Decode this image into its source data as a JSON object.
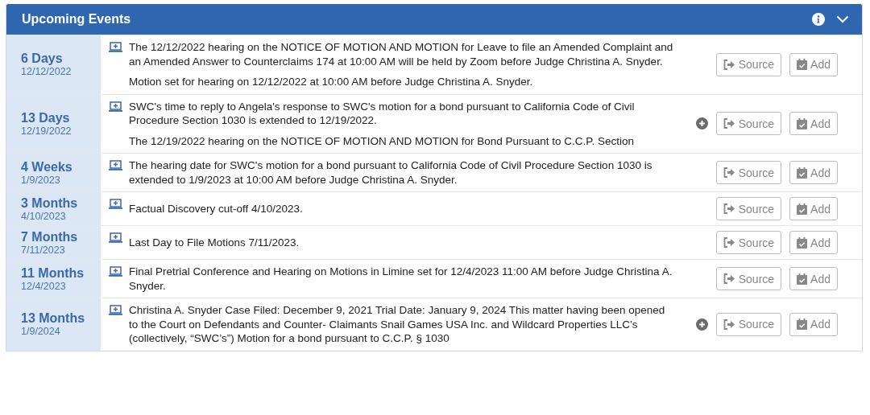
{
  "panel": {
    "title": "Upcoming Events"
  },
  "events": [
    {
      "countdown": "6 Days",
      "date": "12/12/2022",
      "expandable": false,
      "paragraphs": [
        "The 12/12/2022 hearing on the NOTICE OF MOTION AND MOTION for Leave to file an Amended Complaint and an Amended Answer to Counterclaims 174 at 10:00 AM will be held by Zoom before Judge Christina A. Snyder.",
        "Motion set for hearing on 12/12/2022 at 10:00 AM before Judge Christina A. Snyder."
      ],
      "source": "Source",
      "add": "Add"
    },
    {
      "countdown": "13 Days",
      "date": "12/19/2022",
      "expandable": true,
      "paragraphs": [
        "SWC's time to reply to Angela's response to SWC's motion for a bond pursuant to California Code of Civil Procedure Section 1030 is extended to 12/19/2022.",
        "The 12/19/2022 hearing on the NOTICE OF MOTION AND MOTION for Bond Pursuant to C.C.P. Section"
      ],
      "source": "Source",
      "add": "Add"
    },
    {
      "countdown": "4 Weeks",
      "date": "1/9/2023",
      "expandable": false,
      "paragraphs": [
        "The hearing date for SWC's motion for a bond pursuant to California Code of Civil Procedure Section 1030 is extended to 1/9/2023 at 10:00 AM before Judge Christina A. Snyder."
      ],
      "source": "Source",
      "add": "Add"
    },
    {
      "countdown": "3 Months",
      "date": "4/10/2023",
      "expandable": false,
      "paragraphs": [
        "Factual Discovery cut-off 4/10/2023."
      ],
      "source": "Source",
      "add": "Add"
    },
    {
      "countdown": "7 Months",
      "date": "7/11/2023",
      "expandable": false,
      "paragraphs": [
        "Last Day to File Motions 7/11/2023."
      ],
      "source": "Source",
      "add": "Add"
    },
    {
      "countdown": "11 Months",
      "date": "12/4/2023",
      "expandable": false,
      "paragraphs": [
        "Final Pretrial Conference and Hearing on Motions in Limine set for 12/4/2023 11:00 AM before Judge Christina A. Snyder."
      ],
      "source": "Source",
      "add": "Add"
    },
    {
      "countdown": "13 Months",
      "date": "1/9/2024",
      "expandable": true,
      "paragraphs": [
        "Christina A. Snyder Case Filed: December 9, 2021 Trial Date: January 9, 2024 This matter having been opened to the Court on Defendants and Counter- Claimants Snail Games USA Inc. and Wildcard Properties LLC’s (collectively, “SWC’s”) Motion for a bond pursuant to C.C.P. § 1030"
      ],
      "source": "Source",
      "add": "Add"
    }
  ]
}
